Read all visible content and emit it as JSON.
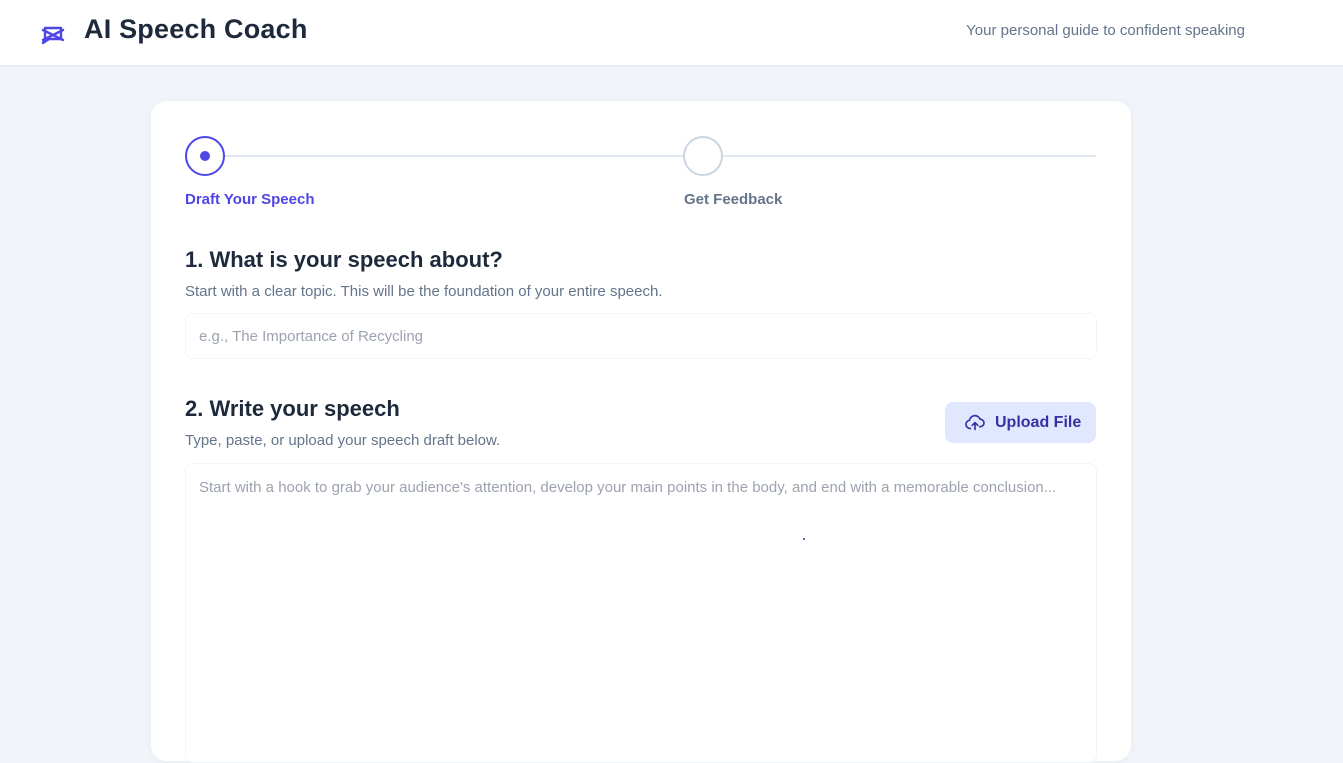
{
  "header": {
    "logo_icon": "speech-bubble-icon",
    "title": "AI Speech Coach",
    "tagline": "Your personal guide to confident speaking"
  },
  "stepper": {
    "steps": [
      {
        "label": "Draft Your Speech",
        "state": "active"
      },
      {
        "label": "Get Feedback",
        "state": "inactive"
      }
    ]
  },
  "topic": {
    "heading": "1. What is your speech about?",
    "description": "Start with a clear topic. This will be the foundation of your entire speech.",
    "value": "",
    "placeholder": "e.g., The Importance of Recycling"
  },
  "speech": {
    "heading": "2. Write your speech",
    "description": "Type, paste, or upload your speech draft below.",
    "upload_label": "Upload File",
    "upload_icon": "cloud-upload-icon",
    "value": "",
    "placeholder": "Start with a hook to grab your audience's attention, develop your main points in the body, and end with a memorable conclusion..."
  },
  "colors": {
    "accent": "#4f46e5",
    "accent_light": "#e0e7ff",
    "text_primary": "#1e293b",
    "text_secondary": "#64748b",
    "background": "#f1f5f9"
  }
}
